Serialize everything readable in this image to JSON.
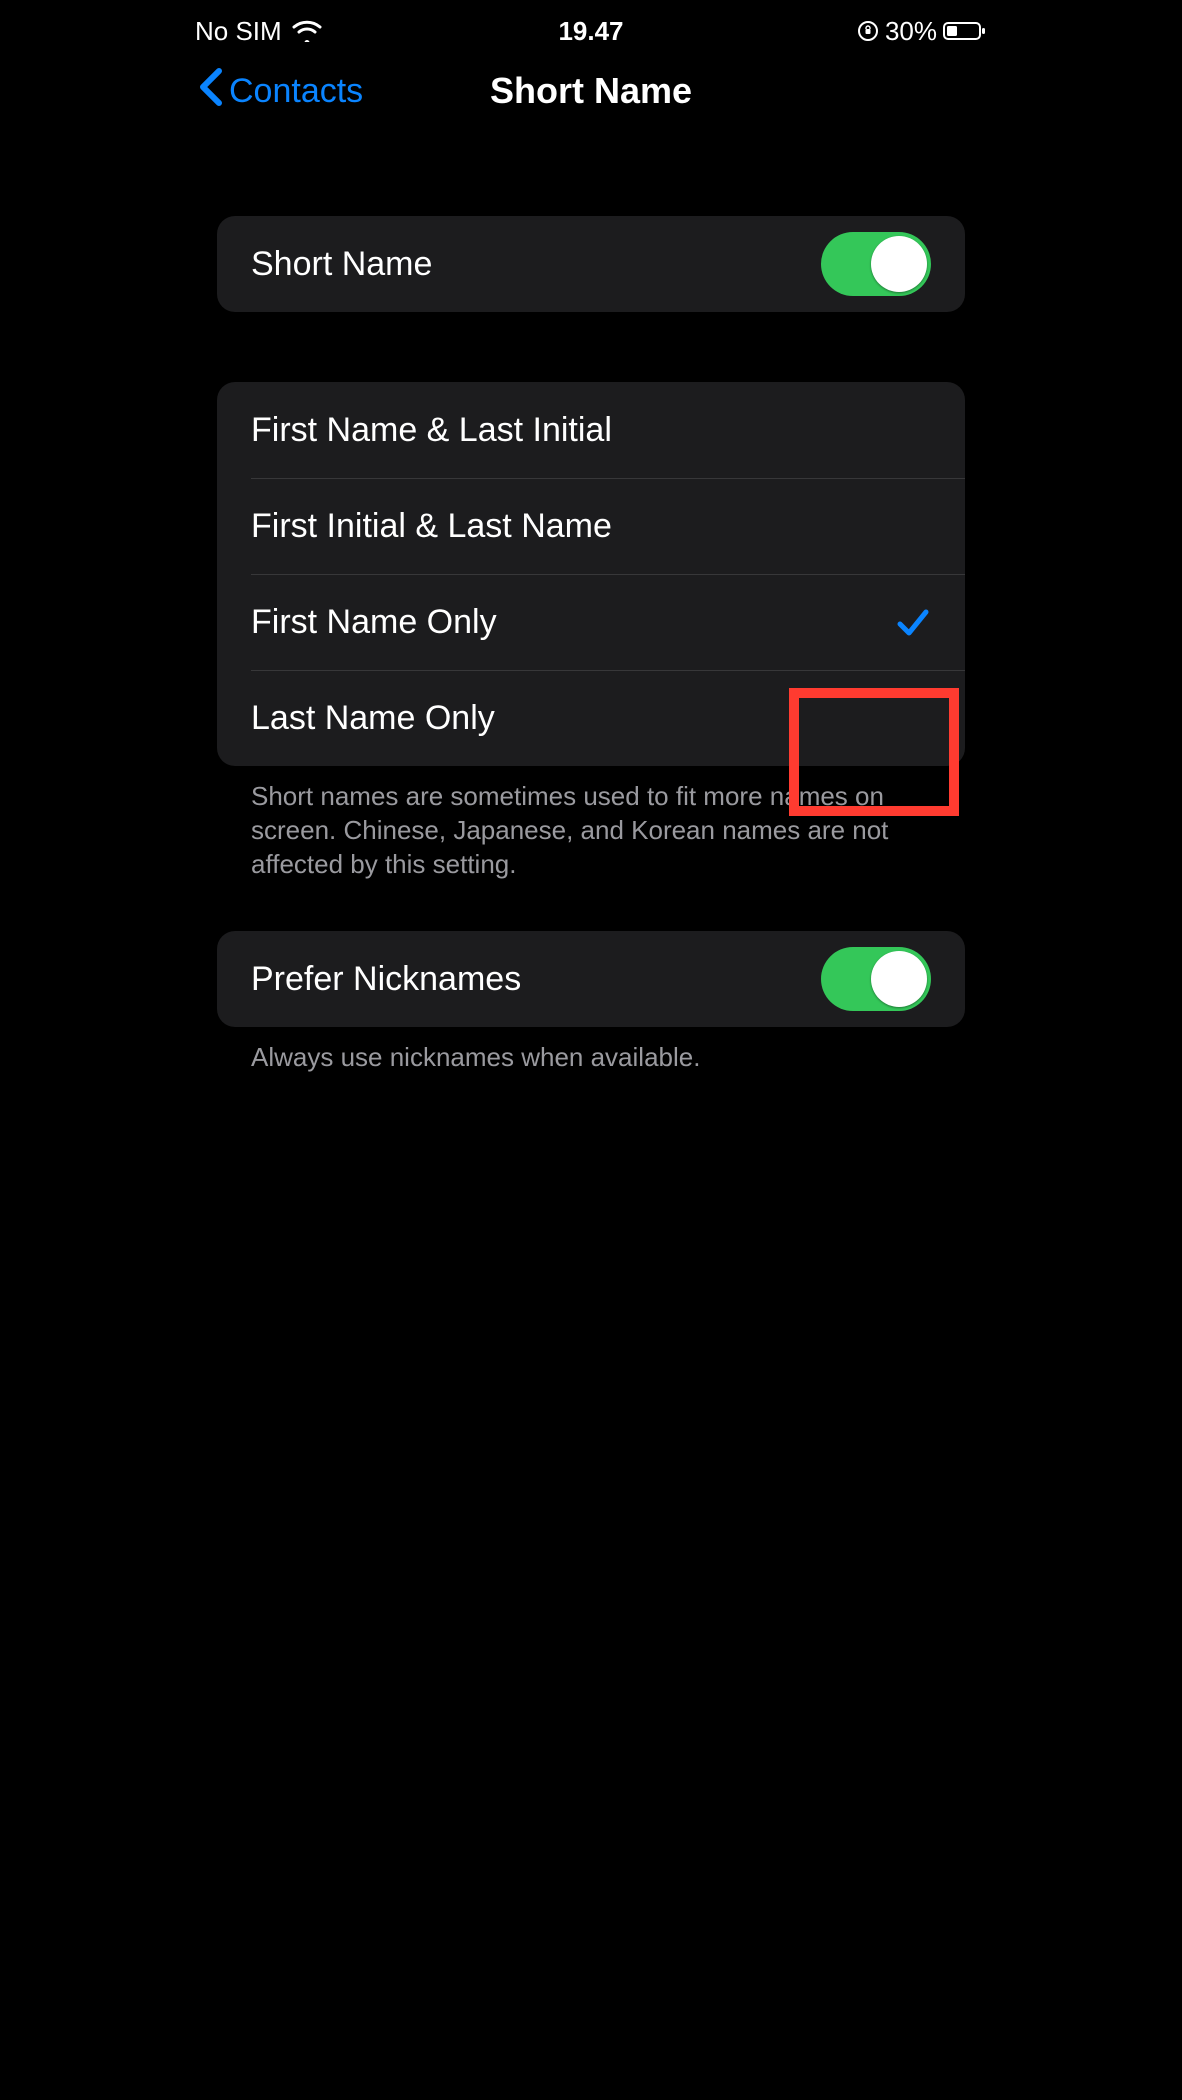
{
  "status": {
    "carrier": "No SIM",
    "time": "19.47",
    "battery_pct": "30%"
  },
  "nav": {
    "back_label": "Contacts",
    "title": "Short Name"
  },
  "section_toggle": {
    "label": "Short Name",
    "enabled": true
  },
  "options": [
    {
      "label": "First Name & Last Initial",
      "selected": false
    },
    {
      "label": "First Initial & Last Name",
      "selected": false
    },
    {
      "label": "First Name Only",
      "selected": true
    },
    {
      "label": "Last Name Only",
      "selected": false
    }
  ],
  "options_footer": "Short names are sometimes used to fit more names on screen. Chinese, Japanese, and Korean names are not affected by this setting.",
  "prefer_nicknames": {
    "label": "Prefer Nicknames",
    "enabled": true
  },
  "prefer_nicknames_footer": "Always use nicknames when available."
}
